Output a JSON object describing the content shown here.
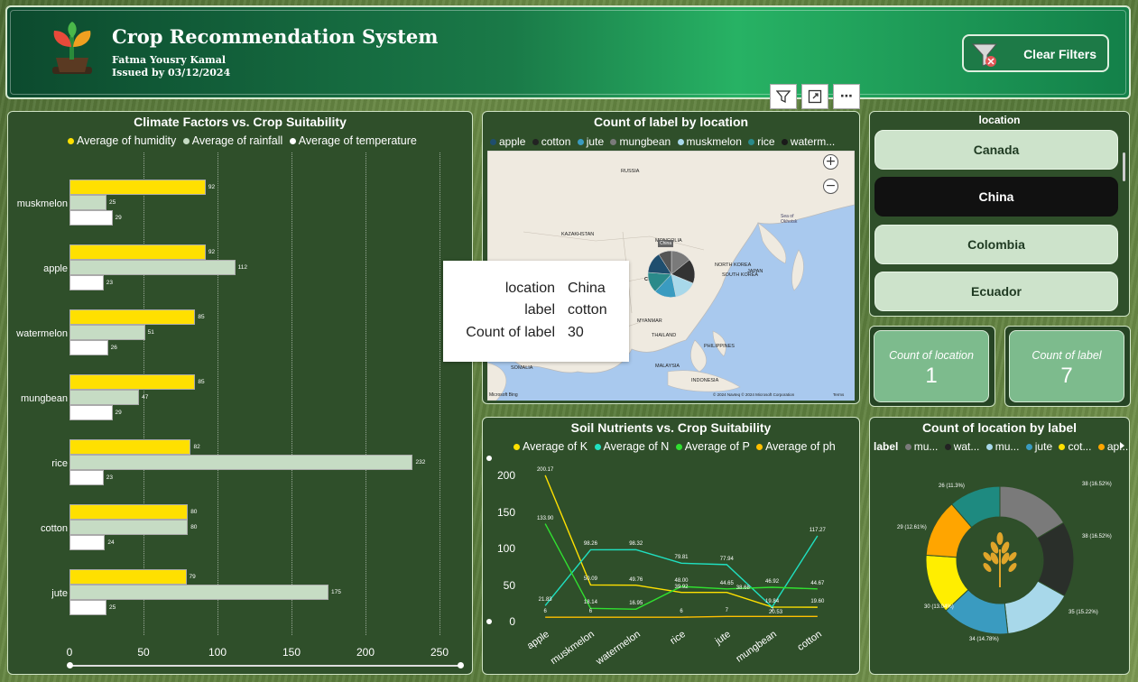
{
  "header": {
    "title": "Crop Recommendation System",
    "author": "Fatma Yousry Kamal",
    "issued": "Issued by 03/12/2024",
    "clear_filters": "Clear Filters"
  },
  "toolbar": {
    "filter_icon": "filter-icon",
    "focus_icon": "focus-mode-icon",
    "more_label": "⋯"
  },
  "climate": {
    "title": "Climate Factors vs. Crop Suitability",
    "legend": [
      "Average of humidity",
      "Average of rainfall",
      "Average of temperature"
    ],
    "colors": [
      "#ffe000",
      "#c6dcc4",
      "#ffffff"
    ],
    "categories": [
      "muskmelon",
      "apple",
      "watermelon",
      "mungbean",
      "rice",
      "cotton",
      "jute"
    ],
    "value_labels": [
      [
        "92",
        "25",
        "29"
      ],
      [
        "92",
        "112",
        "23"
      ],
      [
        "85",
        "51",
        "26"
      ],
      [
        "85",
        "47",
        "29"
      ],
      [
        "82",
        "232",
        "23"
      ],
      [
        "80",
        "80",
        "24"
      ],
      [
        "79",
        "175",
        "25"
      ]
    ],
    "x_ticks": [
      "0",
      "50",
      "100",
      "150",
      "200",
      "250"
    ]
  },
  "map_panel": {
    "title": "Count of label by location",
    "legend": [
      "apple",
      "cotton",
      "jute",
      "mungbean",
      "muskmelon",
      "rice",
      "waterm..."
    ],
    "legend_colors": [
      "#1f4e6e",
      "#222222",
      "#3a9bc0",
      "#7a7a7a",
      "#a8d8ea",
      "#2a8a8a",
      "#1a1a1a"
    ],
    "labels": [
      "RUSSIA",
      "KAZAKHSTAN",
      "MONGOLIA",
      "CHINA",
      "NORTH KOREA",
      "SOUTH KOREA",
      "JAPAN",
      "MYANMAR",
      "THAILAND",
      "PHILIPPINES",
      "MALAYSIA",
      "INDONESIA",
      "SOMALIA",
      "Sea of Okhotsk",
      "China"
    ],
    "credit": "© 2024 Navteq © 2024 Microsoft Corporation",
    "terms": "Terms",
    "bing": "Microsoft Bing",
    "zoom_in": "+",
    "zoom_out": "−"
  },
  "tooltip": {
    "keys": [
      "location",
      "label",
      "Count of label"
    ],
    "values": [
      "China",
      "cotton",
      "30"
    ]
  },
  "location_slicer": {
    "title": "location",
    "items": [
      "Canada",
      "China",
      "Colombia",
      "Ecuador"
    ],
    "selected": "China"
  },
  "cards": [
    {
      "label": "Count of location",
      "value": "1"
    },
    {
      "label": "Count of label",
      "value": "7"
    }
  ],
  "soil": {
    "title": "Soil Nutrients vs. Crop Suitability",
    "legend": [
      "Average of K",
      "Average of N",
      "Average of P",
      "Average of ph"
    ],
    "colors": [
      "#ffe000",
      "#20e0c0",
      "#30e030",
      "#ffc000"
    ],
    "y_ticks": [
      "200",
      "150",
      "100",
      "50",
      "0"
    ],
    "categories": [
      "apple",
      "muskmelon",
      "watermelon",
      "rice",
      "jute",
      "mungbean",
      "cotton"
    ]
  },
  "donut": {
    "title": "Count of location by label",
    "legend_title": "label",
    "legend": [
      "mu...",
      "wat...",
      "mu...",
      "jute",
      "cot...",
      "ap..."
    ],
    "legend_colors": [
      "#7a7a7a",
      "#222222",
      "#a8d8ea",
      "#3a9bc0",
      "#ffe000",
      "#ffa500"
    ],
    "slice_labels": [
      "38 (16.52%)",
      "38 (16.52%)",
      "35 (15.22%)",
      "34 (14.78%)",
      "30 (13.04%)",
      "29 (12.61%)",
      "26 (11.3%)"
    ],
    "center_icon": "wheat-icon"
  },
  "chart_data": [
    {
      "type": "bar",
      "title": "Climate Factors vs. Crop Suitability",
      "categories": [
        "muskmelon",
        "apple",
        "watermelon",
        "mungbean",
        "rice",
        "cotton",
        "jute"
      ],
      "series": [
        {
          "name": "Average of humidity",
          "values": [
            92,
            92,
            85,
            85,
            82,
            80,
            79
          ]
        },
        {
          "name": "Average of rainfall",
          "values": [
            25,
            112,
            51,
            47,
            232,
            80,
            175
          ]
        },
        {
          "name": "Average of temperature",
          "values": [
            29,
            23,
            26,
            29,
            23,
            24,
            25
          ]
        }
      ],
      "xlim": [
        0,
        250
      ],
      "orientation": "horizontal",
      "grid": true,
      "legend": "top"
    },
    {
      "type": "line",
      "title": "Soil Nutrients vs. Crop Suitability",
      "categories": [
        "apple",
        "muskmelon",
        "watermelon",
        "rice",
        "jute",
        "mungbean",
        "cotton"
      ],
      "series": [
        {
          "name": "Average of K",
          "values": [
            200.17,
            50.09,
            49.76,
            39.92,
            39.92,
            19.84,
            19.6
          ],
          "labels": [
            "200.17",
            "50.09",
            "49.76",
            "39.92",
            "",
            "19.84",
            "19.60"
          ]
        },
        {
          "name": "Average of N",
          "values": [
            21.83,
            98.26,
            98.32,
            79.81,
            77.94,
            19.84,
            117.27
          ],
          "labels": [
            "21.83",
            "98.26",
            "98.32",
            "79.81",
            "77.94",
            "",
            "117.27"
          ]
        },
        {
          "name": "Average of P",
          "values": [
            133.9,
            18.14,
            16.95,
            48,
            44.65,
            46.92,
            44.67
          ],
          "labels": [
            "133.90",
            "18.14",
            "16.95",
            "48.00",
            "44.65",
            "46.92",
            "44.67"
          ]
        },
        {
          "name": "Average of ph",
          "values": [
            6,
            6,
            6,
            6,
            7,
            7,
            7
          ],
          "labels": [
            "6",
            "6",
            "",
            "6",
            "7",
            "7",
            ""
          ]
        }
      ],
      "extra_labels": [
        "38.68",
        "20.53"
      ],
      "ylim": [
        0,
        220
      ],
      "legend": "top"
    },
    {
      "type": "pie",
      "title": "Count of location by label",
      "labels": [
        "mungbean",
        "watermelon",
        "muskmelon",
        "jute",
        "cotton",
        "apple",
        "rice"
      ],
      "values": [
        38,
        38,
        35,
        34,
        30,
        29,
        26
      ],
      "colors": [
        "#7a7a7a",
        "#2a2f2a",
        "#a8d8ea",
        "#3a9bc0",
        "#ffee00",
        "#ffa500",
        "#1e8a80"
      ],
      "donut": true,
      "legend": "top"
    }
  ]
}
